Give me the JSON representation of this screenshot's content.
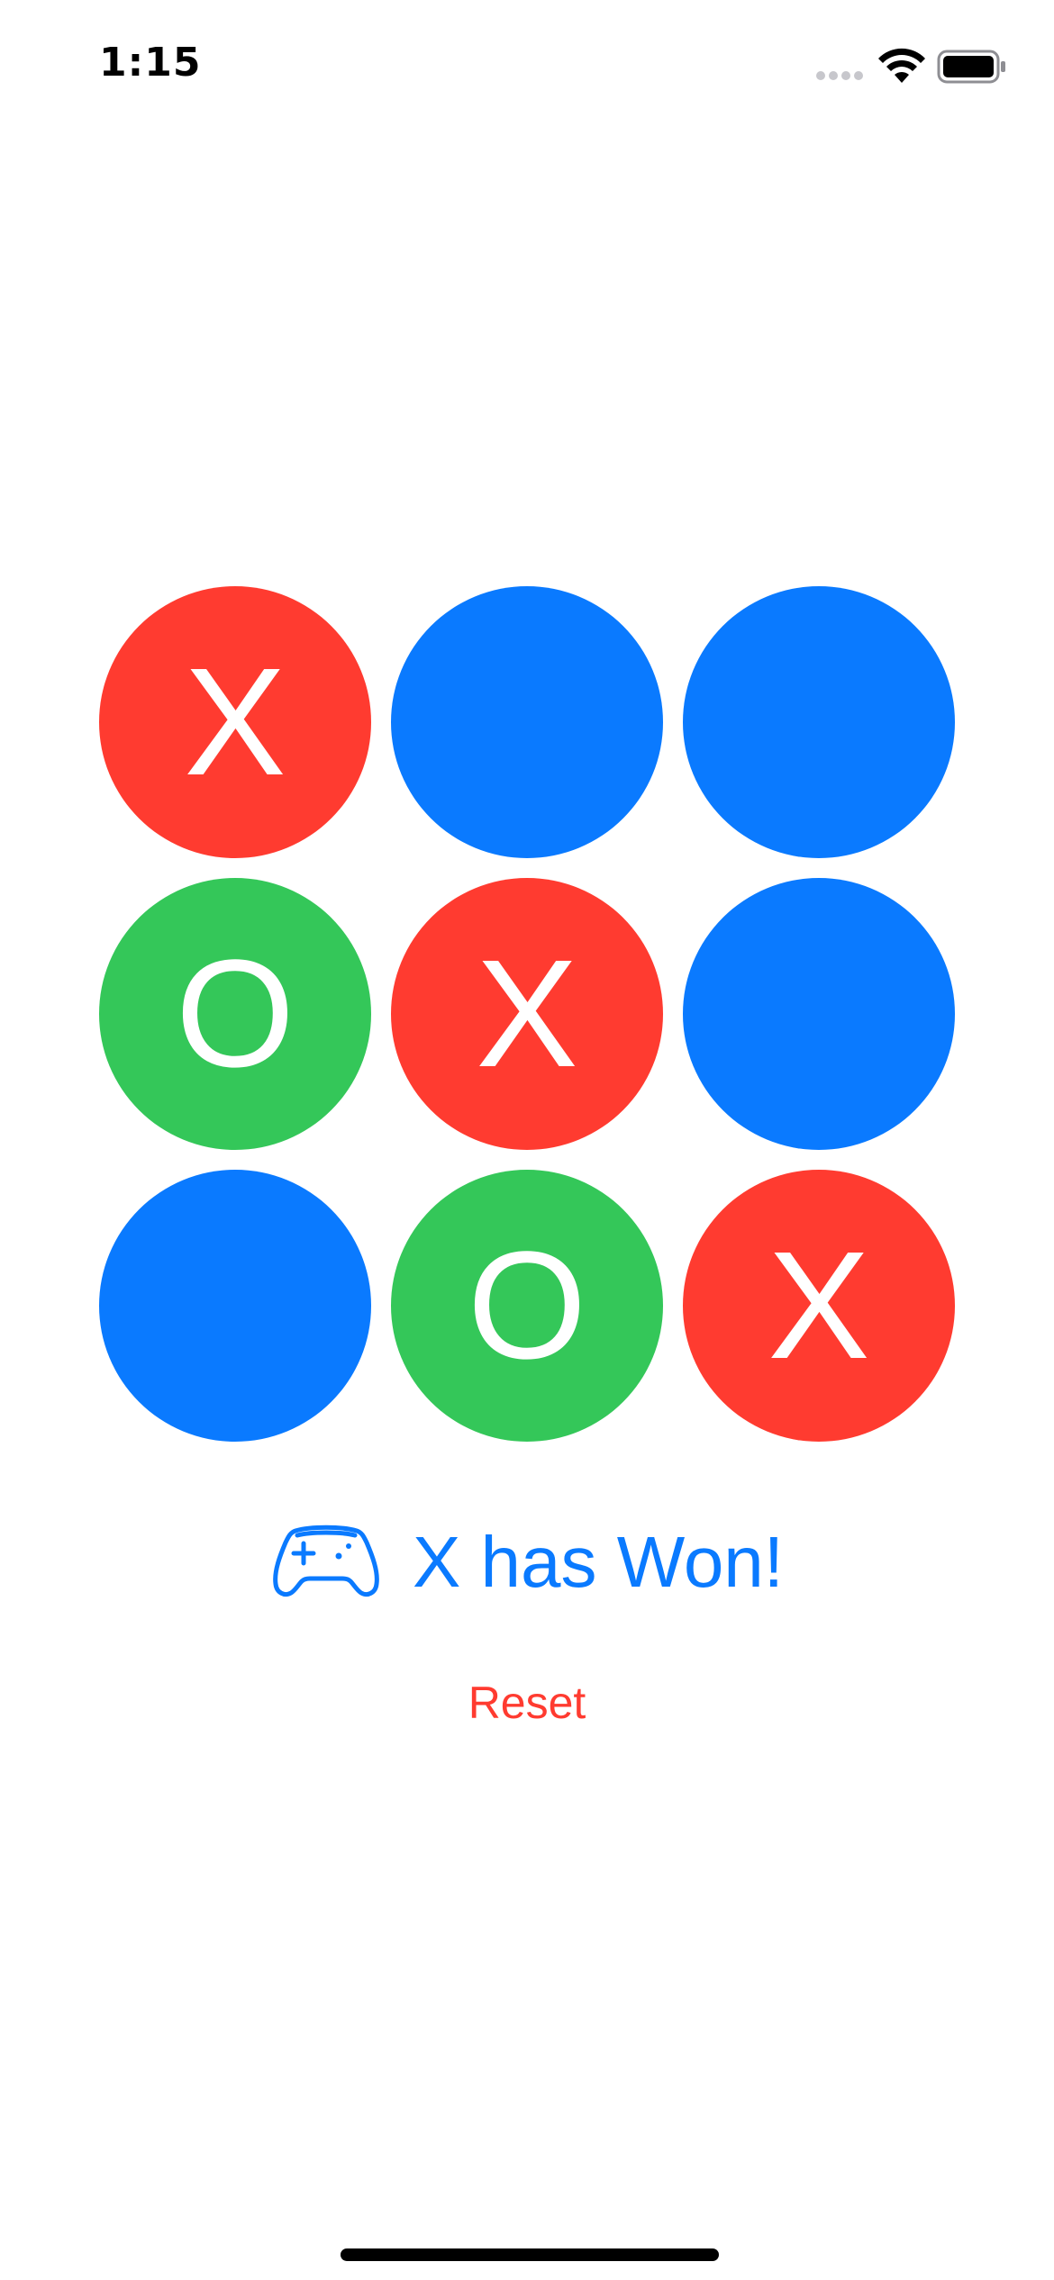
{
  "status_bar": {
    "time": "1:15"
  },
  "board": {
    "cells": [
      {
        "mark": "X",
        "color": "#ff3b30"
      },
      {
        "mark": "",
        "color": "#0a7aff"
      },
      {
        "mark": "",
        "color": "#0a7aff"
      },
      {
        "mark": "O",
        "color": "#34c759"
      },
      {
        "mark": "X",
        "color": "#ff3b30"
      },
      {
        "mark": "",
        "color": "#0a7aff"
      },
      {
        "mark": "",
        "color": "#0a7aff"
      },
      {
        "mark": "O",
        "color": "#34c759"
      },
      {
        "mark": "X",
        "color": "#ff3b30"
      }
    ]
  },
  "status": {
    "icon": "game-controller-icon",
    "message": "X has Won!"
  },
  "actions": {
    "reset_label": "Reset"
  },
  "colors": {
    "x_color": "#ff3b30",
    "o_color": "#34c759",
    "empty_color": "#0a7aff",
    "accent": "#0a7aff",
    "reset_color": "#ff3b30"
  }
}
